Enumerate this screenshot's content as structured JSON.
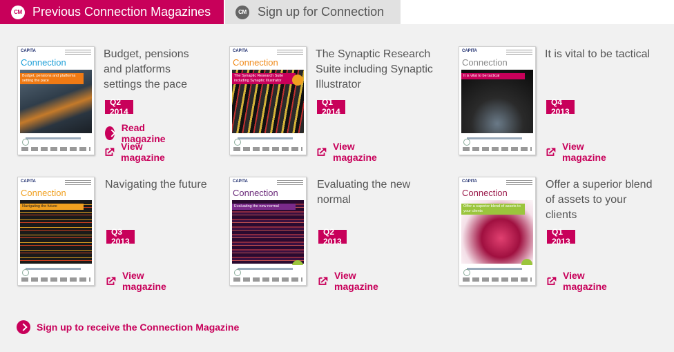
{
  "tabs": {
    "active": {
      "icon_text": "CM",
      "label": "Previous Connection Magazines"
    },
    "inactive": {
      "icon_text": "CM",
      "label": "Sign up for Connection"
    }
  },
  "colors": {
    "accent": "#c8005a",
    "tab_inactive_bg": "#e1e1e1",
    "page_bg": "#f1f1f1",
    "text": "#555555"
  },
  "magazines": [
    {
      "title": "Budget, pensions and platforms settings the pace",
      "issue": "Q2 2014",
      "read_label": "Read magazine",
      "view_label": "View magazine",
      "cover": {
        "brand": "CAPITA",
        "masthead": "Connection",
        "headline": "Budget, pensions and platforms setting the pace"
      }
    },
    {
      "title": "The Synaptic Research Suite including Synaptic Illustrator",
      "issue": "Q1 2014",
      "view_label": "View magazine",
      "cover": {
        "brand": "CAPITA",
        "masthead": "Connection",
        "headline": "The Synaptic Research Suite including Synaptic Illustrator"
      }
    },
    {
      "title": "It is vital to be tactical",
      "issue": "Q4 2013",
      "view_label": "View magazine",
      "cover": {
        "brand": "CAPITA",
        "masthead": "Connection",
        "headline": "It is vital to be tactical"
      }
    },
    {
      "title": "Navigating the future",
      "issue": "Q3 2013",
      "view_label": "View magazine",
      "cover": {
        "brand": "CAPITA",
        "masthead": "Connection",
        "headline": "Navigating the future"
      }
    },
    {
      "title": "Evaluating the new normal",
      "issue": "Q2 2013",
      "view_label": "View magazine",
      "cover": {
        "brand": "CAPITA",
        "masthead": "Connection",
        "headline": "Evaluating the new normal"
      }
    },
    {
      "title": "Offer a superior blend of assets to your clients",
      "issue": "Q1 2013",
      "view_label": "View magazine",
      "cover": {
        "brand": "CAPITA",
        "masthead": "Connection",
        "headline": "Offer a superior blend of assets to your clients"
      }
    }
  ],
  "signup_link": "Sign up to receive the Connection Magazine"
}
